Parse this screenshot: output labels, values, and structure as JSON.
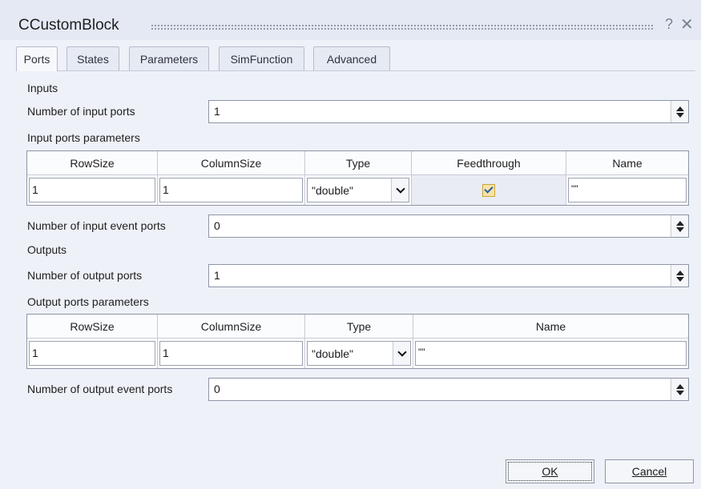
{
  "window": {
    "title": "CCustomBlock",
    "help_glyph": "?",
    "close_glyph": "✕"
  },
  "tabs": [
    {
      "label": "Ports",
      "active": true
    },
    {
      "label": "States",
      "active": false
    },
    {
      "label": "Parameters",
      "active": false
    },
    {
      "label": "SimFunction",
      "active": false
    },
    {
      "label": "Advanced",
      "active": false
    }
  ],
  "inputs": {
    "section_label": "Inputs",
    "num_input_ports_label": "Number of input ports",
    "num_input_ports_value": "1",
    "params_label": "Input ports parameters",
    "columns": [
      "RowSize",
      "ColumnSize",
      "Type",
      "Feedthrough",
      "Name"
    ],
    "row": {
      "rowsize": "1",
      "columnsize": "1",
      "type": "\"double\"",
      "feedthrough": true,
      "name": "\"\""
    },
    "num_event_ports_label": "Number of input event ports",
    "num_event_ports_value": "0"
  },
  "outputs": {
    "section_label": "Outputs",
    "num_output_ports_label": "Number of output ports",
    "num_output_ports_value": "1",
    "params_label": "Output ports parameters",
    "columns": [
      "RowSize",
      "ColumnSize",
      "Type",
      "Name"
    ],
    "row": {
      "rowsize": "1",
      "columnsize": "1",
      "type": "\"double\"",
      "name": "\"\""
    },
    "num_event_ports_label": "Number of output event ports",
    "num_event_ports_value": "0"
  },
  "buttons": {
    "ok": "OK",
    "cancel": "Cancel"
  },
  "colors": {
    "background": "#eef1f8",
    "checkbox_fill": "#f7e3a6",
    "checkmark": "#2b5aa8"
  }
}
